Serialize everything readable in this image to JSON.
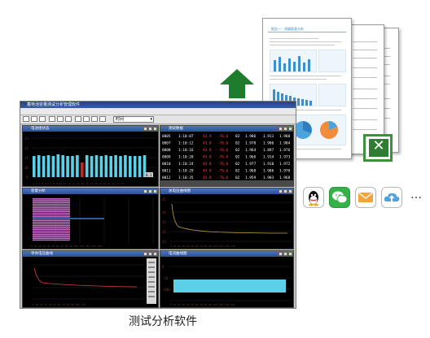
{
  "caption": "测试分析软件",
  "app": {
    "title": "蓄电池容量测试分析管理软件",
    "toolbar_select": "时间",
    "panels": {
      "voltage_bars": {
        "title": "电池组状态"
      },
      "data_table": {
        "title": "测试数据",
        "rows": [
          [
            "0005",
            "1:10:07",
            "43.9",
            "-76.6",
            "02",
            "1.986",
            "1.911",
            "1.988"
          ],
          [
            "0007",
            "1:10:12",
            "43.8",
            "-76.6",
            "02",
            "1.978",
            "1.906",
            "1.984"
          ],
          [
            "0008",
            "1:10:16",
            "43.8",
            "-76.6",
            "02",
            "1.964",
            "1.897",
            "1.976"
          ],
          [
            "0009",
            "1:10:20",
            "43.8",
            "-76.6",
            "02",
            "1.966",
            "1.914",
            "1.973"
          ],
          [
            "0010",
            "1:10:24",
            "43.8",
            "-76.6",
            "02",
            "1.977",
            "1.910",
            "1.972"
          ],
          [
            "0011",
            "1:10:29",
            "43.8",
            "-76.6",
            "02",
            "1.960",
            "1.906",
            "1.970"
          ],
          [
            "0012",
            "1:10:35",
            "43.8",
            "-76.6",
            "02",
            "1.959",
            "1.903",
            "1.968"
          ]
        ]
      },
      "capacity_bars": {
        "title": "容量分析"
      },
      "voltage_curve": {
        "title": "总电压曲线图"
      },
      "single_curve": {
        "title": "单体电压曲线"
      },
      "current_curve": {
        "title": "电流曲线图"
      }
    }
  },
  "report": {
    "title": "报告一：测量报表分析"
  },
  "colors": {
    "accent": "#3d8ecd",
    "window_title": "#2b4f97",
    "panel_bg": "#000000",
    "cyan": "#5bd0e6",
    "magenta": "#c86ac8",
    "excel": "#2f7d32",
    "arrow": "#1d7d2d"
  },
  "share_icons": [
    "qq-icon",
    "wechat-icon",
    "email-icon",
    "cloud-upload-icon"
  ],
  "share_more": "…"
}
